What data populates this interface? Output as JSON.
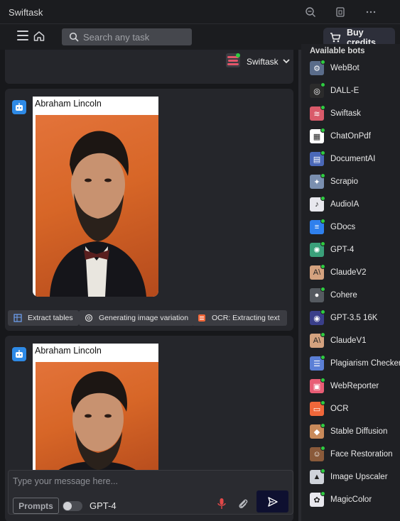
{
  "window": {
    "title": "Swiftask"
  },
  "topbar": {
    "search_placeholder": "Search any task",
    "buy_label": "Buy credits"
  },
  "bot_selector": {
    "selected": "Swiftask"
  },
  "messages": [
    {
      "caption": "Abraham Lincoln"
    },
    {
      "caption": "Abraham Lincoln"
    }
  ],
  "actions": [
    "Extract tables",
    "Generating image variation",
    "OCR: Extracting text"
  ],
  "composer": {
    "placeholder": "Type your message here...",
    "prompts_label": "Prompts",
    "model": "GPT-4"
  },
  "sidebar": {
    "header": "Available bots",
    "bots": [
      {
        "name": "WebBot",
        "color": "#5a6c8a"
      },
      {
        "name": "DALL-E",
        "color": "#2b2b2b"
      },
      {
        "name": "Swiftask",
        "color": "#d95b6a"
      },
      {
        "name": "ChatOnPdf",
        "color": "#ffffff"
      },
      {
        "name": "DocumentAI",
        "color": "#4a68b8"
      },
      {
        "name": "Scrapio",
        "color": "#7a8fb0"
      },
      {
        "name": "AudioIA",
        "color": "#e8e8ee"
      },
      {
        "name": "GDocs",
        "color": "#2f80ed"
      },
      {
        "name": "GPT-4",
        "color": "#3aa07a"
      },
      {
        "name": "ClaudeV2",
        "color": "#d4a27f"
      },
      {
        "name": "Cohere",
        "color": "#555a60"
      },
      {
        "name": "GPT-3.5 16K",
        "color": "#3a3f8a"
      },
      {
        "name": "ClaudeV1",
        "color": "#d4a27f"
      },
      {
        "name": "Plagiarism Checker",
        "color": "#5b7fd6"
      },
      {
        "name": "WebReporter",
        "color": "#e85d75"
      },
      {
        "name": "OCR",
        "color": "#f0673a"
      },
      {
        "name": "Stable Diffusion",
        "color": "#c98a5a"
      },
      {
        "name": "Face Restoration",
        "color": "#8a5a3a"
      },
      {
        "name": "Image Upscaler",
        "color": "#cfd3da"
      },
      {
        "name": "MagicColor",
        "color": "#e8e8ee"
      }
    ]
  }
}
